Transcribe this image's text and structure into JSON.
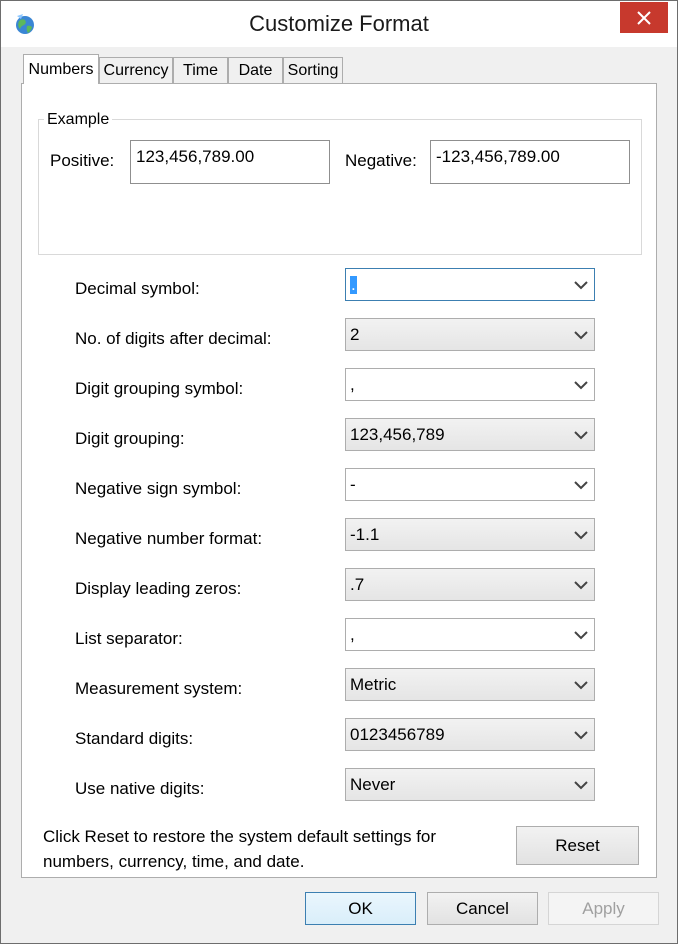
{
  "window": {
    "title": "Customize Format"
  },
  "tabs": [
    {
      "label": "Numbers",
      "active": true
    },
    {
      "label": "Currency",
      "active": false
    },
    {
      "label": "Time",
      "active": false
    },
    {
      "label": "Date",
      "active": false
    },
    {
      "label": "Sorting",
      "active": false
    }
  ],
  "example": {
    "group_label": "Example",
    "positive_label": "Positive:",
    "positive_value": "123,456,789.00",
    "negative_label": "Negative:",
    "negative_value": "-123,456,789.00"
  },
  "settings": [
    {
      "label": "Decimal symbol:",
      "value": "."
    },
    {
      "label": "No. of digits after decimal:",
      "value": "2"
    },
    {
      "label": "Digit grouping symbol:",
      "value": ","
    },
    {
      "label": "Digit grouping:",
      "value": "123,456,789"
    },
    {
      "label": "Negative sign symbol:",
      "value": "-"
    },
    {
      "label": "Negative number format:",
      "value": "-1.1"
    },
    {
      "label": "Display leading zeros:",
      "value": ".7"
    },
    {
      "label": "List separator:",
      "value": ","
    },
    {
      "label": "Measurement system:",
      "value": "Metric"
    },
    {
      "label": "Standard digits:",
      "value": "0123456789"
    },
    {
      "label": "Use native digits:",
      "value": "Never"
    }
  ],
  "reset_note_line1": "Click Reset to restore the system default settings for",
  "reset_note_line2": "numbers, currency, time, and date.",
  "buttons": {
    "reset": "Reset",
    "ok": "OK",
    "cancel": "Cancel",
    "apply": "Apply"
  },
  "colors": {
    "close_button": "#c7392d",
    "focus_border": "#3c7fb1",
    "selection": "#3399ff"
  }
}
